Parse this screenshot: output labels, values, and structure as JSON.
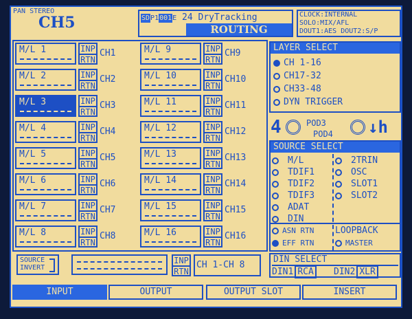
{
  "header": {
    "pan_mode": "PAN STEREO",
    "channel": "CH5",
    "scene_tag": "SD",
    "scene_prefix": "P1",
    "scene_number": "001",
    "scene_suffix": "E",
    "scene_name": "24 DryTracking",
    "page_title": "ROUTING",
    "clock": "CLOCK:INTERNAL",
    "solo": "SOLO:MIX/AFL",
    "dout": "DOUT1:AES  DOUT2:S/P"
  },
  "routing_rows": [
    {
      "left_label": "M/L 1",
      "left_ch": "CH1",
      "right_label": "M/L 9",
      "right_ch": "CH9"
    },
    {
      "left_label": "M/L 2",
      "left_ch": "CH2",
      "right_label": "M/L 10",
      "right_ch": "CH10"
    },
    {
      "left_label": "M/L 3",
      "left_ch": "CH3",
      "right_label": "M/L 11",
      "right_ch": "CH11"
    },
    {
      "left_label": "M/L 4",
      "left_ch": "CH4",
      "right_label": "M/L 12",
      "right_ch": "CH12"
    },
    {
      "left_label": "M/L 5",
      "left_ch": "CH5",
      "right_label": "M/L 13",
      "right_ch": "CH13"
    },
    {
      "left_label": "M/L 6",
      "left_ch": "CH6",
      "right_label": "M/L 14",
      "right_ch": "CH14"
    },
    {
      "left_label": "M/L 7",
      "left_ch": "CH7",
      "right_label": "M/L 15",
      "right_ch": "CH15"
    },
    {
      "left_label": "M/L 8",
      "left_ch": "CH8",
      "right_label": "M/L 16",
      "right_ch": "CH16"
    }
  ],
  "inp_label": "INP",
  "rtn_label": "RTN",
  "source_invert": {
    "line1": "SOURCE",
    "line2": "INVERT"
  },
  "bottom_range": "CH 1-CH 8",
  "layer_select": {
    "title": "LAYER SELECT",
    "options": [
      "CH 1-16",
      "CH17-32",
      "CH33-48",
      "DYN TRIGGER"
    ],
    "selected": 0
  },
  "pods": {
    "pod3": "POD3",
    "pod4": "POD4"
  },
  "source_select": {
    "title": "SOURCE SELECT",
    "left": [
      "M/L",
      "TDIF1",
      "TDIF2",
      "TDIF3",
      "ADAT",
      "DIN"
    ],
    "right": [
      "2TRIN",
      "OSC",
      "SLOT1",
      "SLOT2"
    ],
    "asn_rtn": "ASN RTN",
    "eff_rtn": "EFF RTN",
    "loopback": "LOOPBACK",
    "master": "MASTER"
  },
  "din_select": {
    "title": "DIN SELECT",
    "din1": "DIN1",
    "din1_val": "RCA",
    "din2": "DIN2",
    "din2_val": "XLR"
  },
  "tabs": [
    "INPUT",
    "OUTPUT",
    "OUTPUT SLOT",
    "INSERT"
  ],
  "colors": {
    "background": "#f1dc9e",
    "accent": "#1d4fc4",
    "highlight": "#2a66e0"
  }
}
